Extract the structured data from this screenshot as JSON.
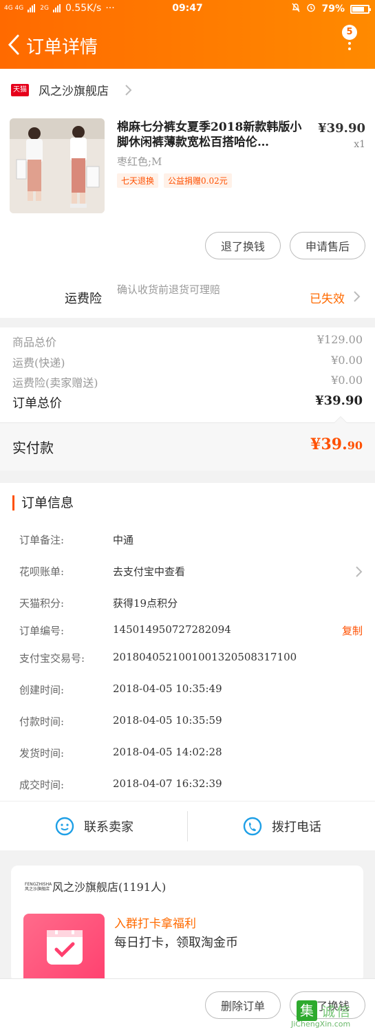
{
  "status_bar": {
    "network": "4G 4G",
    "signal_label": "2G",
    "speed": "0.55K/s",
    "more": "···",
    "time": "09:47",
    "battery_pct": "79%",
    "battery_level": 0.79
  },
  "nav": {
    "title": "订单详情",
    "badge_count": "5"
  },
  "shop": {
    "logo_text": "天猫",
    "name": "风之沙旗舰店"
  },
  "product": {
    "title": "棉麻七分裤女夏季2018新款韩版小脚休闲裤薄款宽松百搭哈伦…",
    "price": "¥39.90",
    "qty": "x1",
    "sku": "枣红色;M",
    "tags": [
      "七天退换",
      "公益捐赠0.02元"
    ],
    "buttons": {
      "refund": "退了换钱",
      "service": "申请售后"
    }
  },
  "insurance": {
    "label": "运费险",
    "desc": "确认收货前退货可理赔",
    "status": "已失效"
  },
  "price_summary": {
    "rows": [
      {
        "label": "商品总价",
        "value": "¥129.00"
      },
      {
        "label": "运费(快递)",
        "value": "¥0.00"
      },
      {
        "label": "运费险(卖家赠送)",
        "value": "¥0.00"
      }
    ],
    "total_label": "订单总价",
    "total_value": "¥39.90"
  },
  "payment": {
    "label": "实付款",
    "amount_main": "¥39.",
    "amount_dec": "90"
  },
  "order_info": {
    "title": "订单信息",
    "rows": [
      {
        "key": "订单备注:",
        "value": "中通"
      },
      {
        "key": "花呗账单:",
        "value": "去支付宝中查看"
      },
      {
        "key": "天猫积分:",
        "value": "获得19点积分"
      },
      {
        "key": "订单编号:",
        "value": "145014950727282094",
        "action": "复制"
      },
      {
        "key": "支付宝交易号:",
        "value": "2018040521001001320508317100"
      },
      {
        "key": "创建时间:",
        "value": "2018-04-05 10:35:49"
      },
      {
        "key": "付款时间:",
        "value": "2018-04-05 10:35:59"
      },
      {
        "key": "发货时间:",
        "value": "2018-04-05 14:02:28"
      },
      {
        "key": "成交时间:",
        "value": "2018-04-07 16:32:39"
      }
    ]
  },
  "contact": {
    "seller": "联系卖家",
    "call": "拨打电话"
  },
  "group": {
    "logo_text": "FENGZHISHA 风之沙旗舰店",
    "name": "风之沙旗舰店(1191人)",
    "line1": "入群打卡拿福利",
    "line2": "每日打卡，领取淘金币"
  },
  "bottom_bar": {
    "delete": "删除订单",
    "refund": "退了换钱"
  },
  "watermark": {
    "char": "集",
    "text": "诚信",
    "url": "JiChengXin.com"
  },
  "colors": {
    "accent": "#ff6a00",
    "price_red": "#ff5000",
    "tmall_red": "#e6001b"
  }
}
